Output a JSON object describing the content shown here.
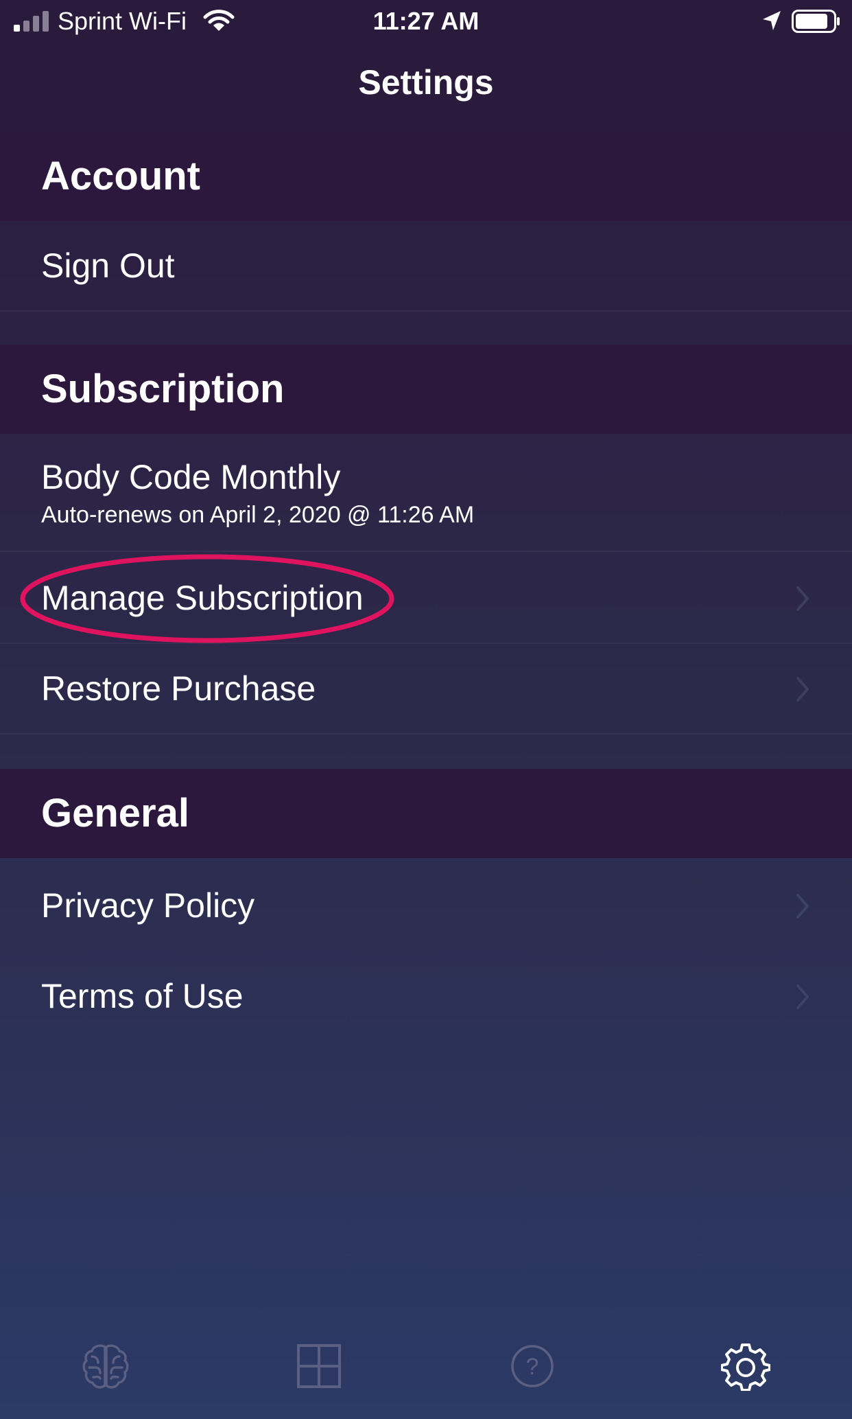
{
  "status_bar": {
    "carrier": "Sprint Wi-Fi",
    "time": "11:27 AM"
  },
  "nav": {
    "title": "Settings"
  },
  "account": {
    "header": "Account",
    "items": [
      {
        "label": "Sign Out"
      }
    ]
  },
  "subscription": {
    "header": "Subscription",
    "plan_name": "Body Code Monthly",
    "plan_detail": "Auto-renews on April 2, 2020 @ 11:26 AM",
    "items": [
      {
        "label": "Manage Subscription",
        "highlighted": true
      },
      {
        "label": "Restore Purchase"
      }
    ]
  },
  "general": {
    "header": "General",
    "items": [
      {
        "label": "Privacy Policy"
      },
      {
        "label": "Terms of Use"
      }
    ]
  },
  "tab_bar": {
    "tabs": [
      {
        "icon": "brain-icon",
        "selected": false
      },
      {
        "icon": "grid-icon",
        "selected": false
      },
      {
        "icon": "help-icon",
        "selected": false
      },
      {
        "icon": "gear-icon",
        "selected": true
      }
    ]
  },
  "colors": {
    "header_background": "#2c173d",
    "highlight_ring": "#e0145e",
    "inactive_icon": "#5b5f82",
    "active_icon": "#ffffff"
  }
}
